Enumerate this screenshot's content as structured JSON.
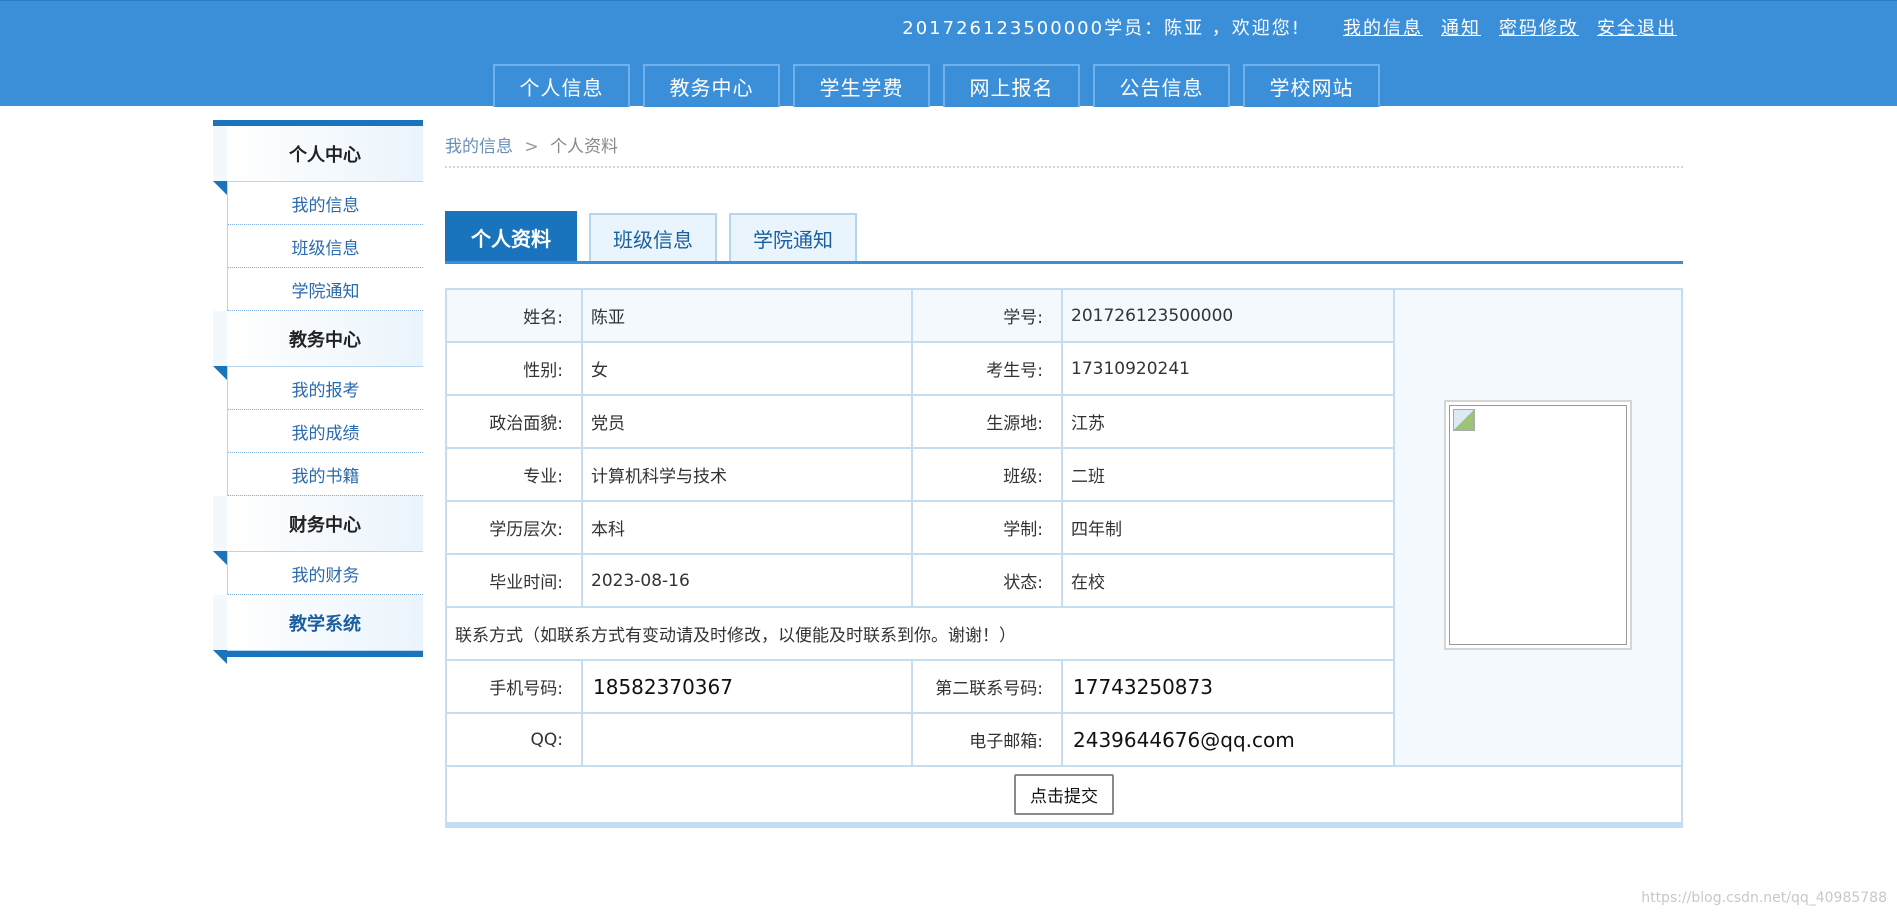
{
  "header": {
    "welcome": "201726123500000学员：陈亚 ，欢迎您!",
    "links": [
      "我的信息",
      "通知",
      "密码修改",
      "安全退出"
    ],
    "nav": [
      "个人信息",
      "教务中心",
      "学生学费",
      "网上报名",
      "公告信息",
      "学校网站"
    ],
    "colors": {
      "bar": "#3a8fd8",
      "accent": "#1a73bd"
    }
  },
  "sidebar": {
    "groups": [
      {
        "title": "个人中心",
        "items": [
          "我的信息",
          "班级信息",
          "学院通知"
        ]
      },
      {
        "title": "教务中心",
        "items": [
          "我的报考",
          "我的成绩",
          "我的书籍"
        ]
      },
      {
        "title": "财务中心",
        "items": [
          "我的财务"
        ]
      },
      {
        "title": "教学系统",
        "items": []
      }
    ]
  },
  "breadcrumb": {
    "parent": "我的信息",
    "separator": ">",
    "current": "个人资料"
  },
  "tabs": [
    "个人资料",
    "班级信息",
    "学院通知"
  ],
  "profile": {
    "rows": [
      {
        "l1": "姓名:",
        "v1": "陈亚",
        "l2": "学号:",
        "v2": "201726123500000"
      },
      {
        "l1": "性别:",
        "v1": "女",
        "l2": "考生号:",
        "v2": "17310920241"
      },
      {
        "l1": "政治面貌:",
        "v1": "党员",
        "l2": "生源地:",
        "v2": "江苏"
      },
      {
        "l1": "专业:",
        "v1": "计算机科学与技术",
        "l2": "班级:",
        "v2": "二班"
      },
      {
        "l1": "学历层次:",
        "v1": "本科",
        "l2": "学制:",
        "v2": "四年制"
      },
      {
        "l1": "毕业时间:",
        "v1": "2023-08-16",
        "l2": "状态:",
        "v2": "在校"
      }
    ],
    "contact_note": "联系方式（如联系方式有变动请及时修改，以便能及时联系到你。谢谢！）",
    "contacts": [
      {
        "l1": "手机号码:",
        "v1": "18582370367",
        "l2": "第二联系号码:",
        "v2": "17743250873"
      },
      {
        "l1": "QQ:",
        "v1": "",
        "l2": "电子邮箱:",
        "v2": "2439644676@qq.com"
      }
    ],
    "submit_label": "点击提交"
  },
  "watermark": "https://blog.csdn.net/qq_40985788"
}
